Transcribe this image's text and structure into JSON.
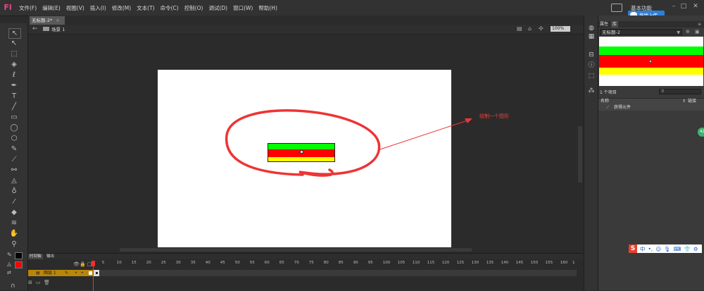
{
  "menubar": {
    "logo": "Fl",
    "items": [
      "文件(F)",
      "编辑(E)",
      "视图(V)",
      "插入(I)",
      "修改(M)",
      "文本(T)",
      "命令(C)",
      "控制(O)",
      "调试(D)",
      "窗口(W)",
      "帮助(H)"
    ],
    "workspace_label": "基本功能",
    "upload_label": "拖拽上传"
  },
  "document": {
    "tab_label": "无标题-2*",
    "scene_label": "场景 1",
    "zoom": "100%"
  },
  "stage": {
    "canvas_color": "#ffffff",
    "shape_colors": [
      "#00ff00",
      "#ff0000",
      "#ffff00"
    ],
    "annotation_text": "绘制一个图形",
    "annotation_color": "#ff3b3b"
  },
  "library": {
    "tabs": [
      "属性",
      "库"
    ],
    "document_select": "无标题-2",
    "item_count": "1 个项目",
    "col_name": "名称",
    "col_linkage": "链接",
    "items": [
      {
        "name": "获得元件"
      }
    ]
  },
  "side_badge": "42",
  "ime": {
    "logo": "S",
    "lang": "中"
  },
  "timeline": {
    "tabs": [
      "时间轴",
      "输出"
    ],
    "ruler_ticks": [
      "1",
      "5",
      "10",
      "15",
      "20",
      "25",
      "30",
      "35",
      "40",
      "45",
      "50",
      "55",
      "60",
      "65",
      "70",
      "75",
      "80",
      "85",
      "90",
      "95",
      "100",
      "105",
      "110",
      "115",
      "120",
      "125",
      "130",
      "135",
      "140",
      "145",
      "150",
      "155",
      "160",
      "1"
    ],
    "layer_name": "图层 1"
  }
}
